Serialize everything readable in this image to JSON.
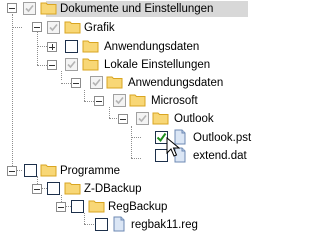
{
  "tree": {
    "nodes": [
      {
        "id": "root",
        "label": "Dokumente und Einstellungen",
        "check": "partial-gray",
        "icon": "folder-icon",
        "expander": "minus"
      },
      {
        "id": "grafik",
        "label": "Grafik",
        "check": "partial-gray",
        "icon": "folder-icon",
        "expander": "minus"
      },
      {
        "id": "anwendungsdaten1",
        "label": "Anwendungsdaten",
        "check": "unchecked",
        "icon": "folder-icon",
        "expander": "plus"
      },
      {
        "id": "lokale",
        "label": "Lokale Einstellungen",
        "check": "partial-gray",
        "icon": "folder-icon",
        "expander": "minus"
      },
      {
        "id": "anwendungsdaten2",
        "label": "Anwendungsdaten",
        "check": "partial-gray",
        "icon": "folder-icon",
        "expander": "minus"
      },
      {
        "id": "microsoft",
        "label": "Microsoft",
        "check": "partial-gray",
        "icon": "folder-icon",
        "expander": "minus"
      },
      {
        "id": "outlook",
        "label": "Outlook",
        "check": "partial-gray",
        "icon": "folder-icon",
        "expander": "minus"
      },
      {
        "id": "outlookpst",
        "label": "Outlook.pst",
        "check": "checked",
        "icon": "file-icon",
        "expander": "none"
      },
      {
        "id": "extenddat",
        "label": "extend.dat",
        "check": "unchecked",
        "icon": "file-icon",
        "expander": "none"
      },
      {
        "id": "programme",
        "label": "Programme",
        "check": "unchecked",
        "icon": "folder-icon",
        "expander": "minus"
      },
      {
        "id": "zdbackup",
        "label": "Z-DBackup",
        "check": "unchecked",
        "icon": "folder-icon",
        "expander": "minus"
      },
      {
        "id": "regbackup",
        "label": "RegBackup",
        "check": "unchecked",
        "icon": "folder-icon",
        "expander": "minus"
      },
      {
        "id": "regbak",
        "label": "regbak11.reg",
        "check": "unchecked",
        "icon": "file-icon",
        "expander": "none"
      }
    ]
  },
  "colors": {
    "folder_fill": "#f8d776",
    "folder_dark": "#d9a521",
    "check_green": "#1e8f1e",
    "file_blue": "#b8cbe6"
  }
}
